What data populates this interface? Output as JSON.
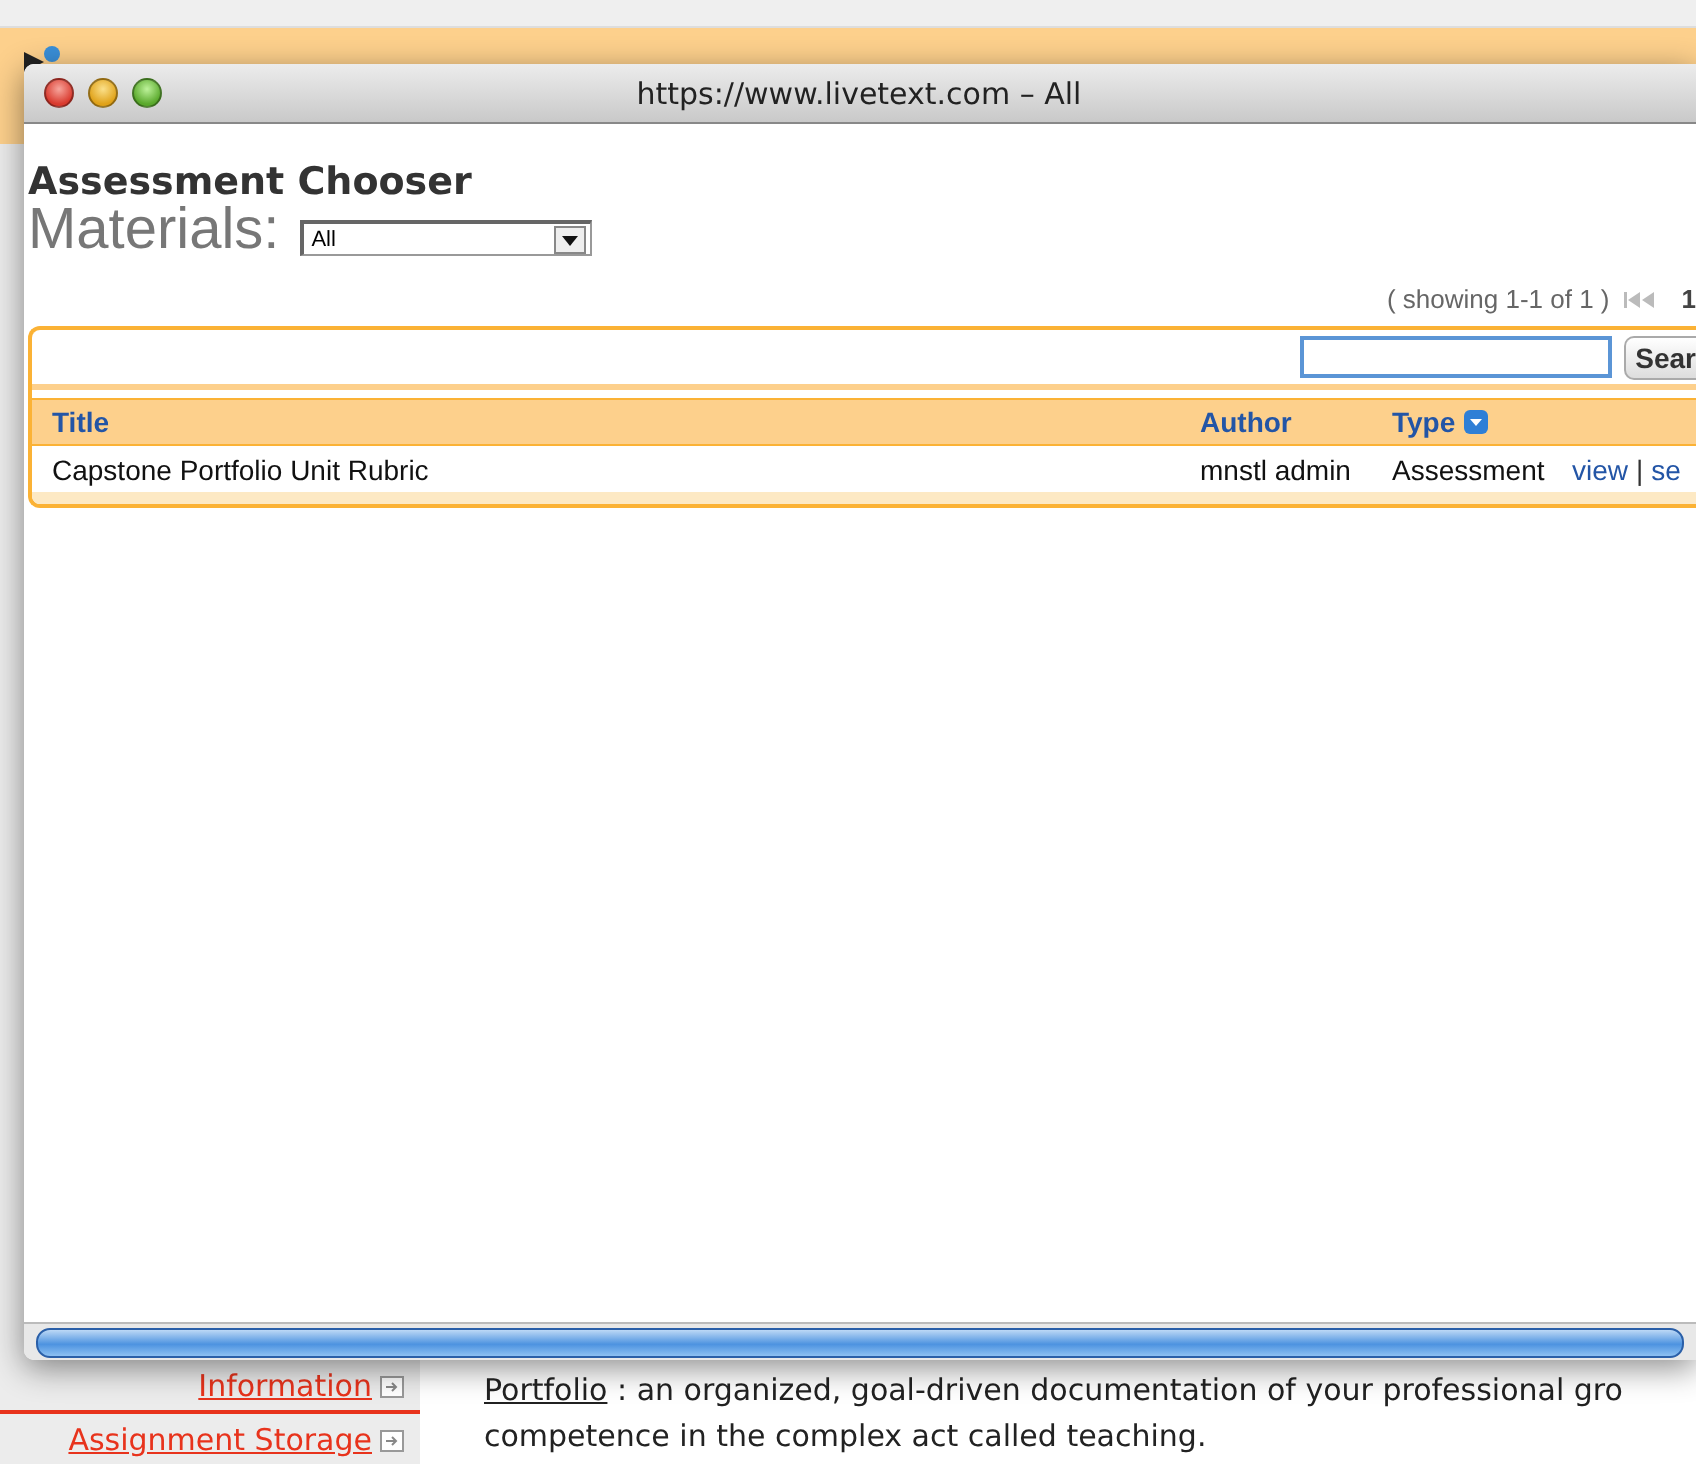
{
  "background_page": {
    "sidebar": {
      "items": [
        {
          "label": "Information"
        },
        {
          "label": "Assignment Storage"
        }
      ]
    },
    "definition": {
      "term": "Portfolio",
      "lines": [
        ": an organized, goal-driven documentation of your professional gro",
        "competence in the complex act called teaching."
      ]
    }
  },
  "popup": {
    "title": "https://www.livetext.com – All",
    "heading": "Assessment Chooser",
    "materials": {
      "label": "Materials:",
      "value": "All"
    },
    "pager": {
      "text": "( showing 1-1 of 1 )",
      "page": "1"
    },
    "search": {
      "button": "Sear"
    },
    "table": {
      "columns": [
        {
          "label": "Title",
          "sortable": false
        },
        {
          "label": "Author",
          "sortable": false
        },
        {
          "label": "Type",
          "sortable": true
        }
      ],
      "rows": [
        {
          "title": "Capstone Portfolio Unit Rubric",
          "author": "mnstl admin",
          "type": "Assessment",
          "actions": [
            {
              "kind": "link",
              "text": "view"
            },
            {
              "kind": "separator",
              "text": "|"
            },
            {
              "kind": "link",
              "text": "se"
            }
          ]
        }
      ]
    }
  }
}
